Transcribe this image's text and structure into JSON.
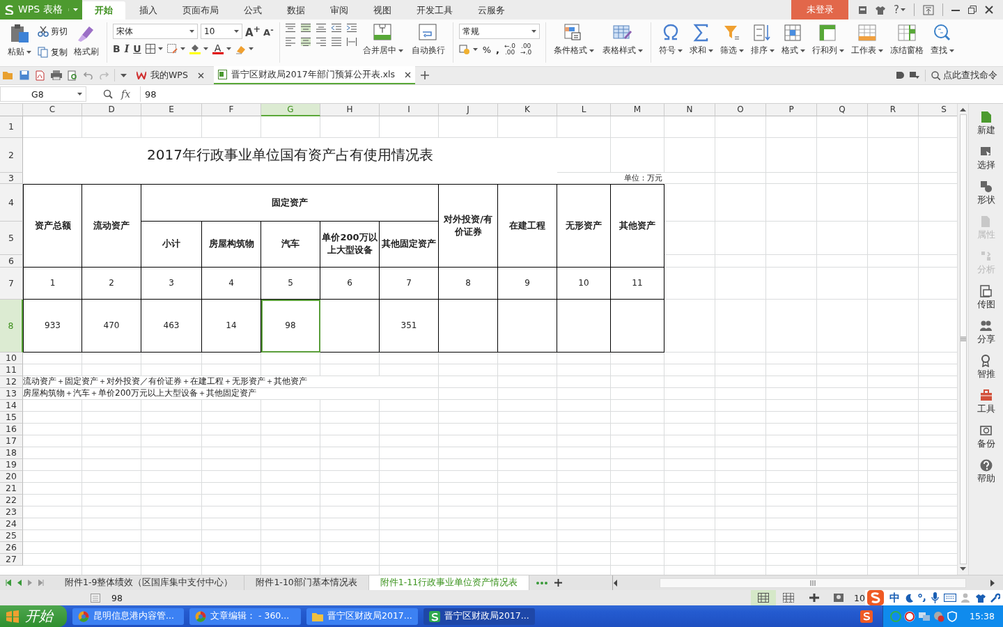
{
  "app_menu": {
    "label": "WPS 表格"
  },
  "ribbon_tabs": [
    {
      "label": "开始",
      "selected": true
    },
    {
      "label": "插入",
      "selected": false
    },
    {
      "label": "页面布局",
      "selected": false
    },
    {
      "label": "公式",
      "selected": false
    },
    {
      "label": "数据",
      "selected": false
    },
    {
      "label": "审阅",
      "selected": false
    },
    {
      "label": "视图",
      "selected": false
    },
    {
      "label": "开发工具",
      "selected": false
    },
    {
      "label": "云服务",
      "selected": false
    }
  ],
  "login_button": "未登录",
  "help_label": "?",
  "clipboard": {
    "paste": "粘贴",
    "cut": "剪切",
    "copy": "复制",
    "format_painter": "格式刷"
  },
  "font": {
    "name": "宋体",
    "size": "10",
    "grow": "A$^{+}$",
    "shrink": "A$^{-}$",
    "styles": [
      "B",
      "I",
      "U"
    ],
    "font_color_label": "A"
  },
  "alignment_buttons": [
    {
      "label": "合并居中",
      "kind": "merge",
      "menu": true
    },
    {
      "label": "自动换行",
      "kind": "wrap",
      "menu": false
    }
  ],
  "number": {
    "format": "常规",
    "percent": "%",
    "comma": ",",
    "decimals": [
      {
        "top": "←.0",
        "bottom": ".00"
      },
      {
        "top": ".00",
        "bottom": "→.0"
      }
    ]
  },
  "style_buttons": [
    {
      "label": "条件格式",
      "kind": "conditional",
      "menu": true
    },
    {
      "label": "表格样式",
      "kind": "table_style",
      "menu": true
    }
  ],
  "tool_buttons": [
    {
      "label": "符号",
      "kind": "symbol",
      "menu": true
    },
    {
      "label": "求和",
      "kind": "sum",
      "menu": true
    },
    {
      "label": "筛选",
      "kind": "filter",
      "menu": true
    },
    {
      "label": "排序",
      "kind": "sort",
      "menu": true
    },
    {
      "label": "格式",
      "kind": "format",
      "menu": true
    },
    {
      "label": "行和列",
      "kind": "rows_cols",
      "menu": true
    },
    {
      "label": "工作表",
      "kind": "sheet",
      "menu": true
    },
    {
      "label": "冻结窗格",
      "kind": "freeze",
      "menu": false
    },
    {
      "label": "查找",
      "kind": "find",
      "menu": true
    }
  ],
  "doc_tabs": [
    {
      "label": "我的WPS",
      "kind": "home",
      "selected": false
    },
    {
      "label": "晋宁区财政局2017年部门预算公开表.xls",
      "kind": "sheet",
      "selected": true
    }
  ],
  "command_search": {
    "placeholder": "点此查找命令"
  },
  "formula_bar": {
    "name_box": "G8",
    "fx": "fx",
    "value": "98"
  },
  "columns": [
    {
      "label": "C",
      "selected": false
    },
    {
      "label": "D",
      "selected": false
    },
    {
      "label": "E",
      "selected": false
    },
    {
      "label": "F",
      "selected": false
    },
    {
      "label": "G",
      "selected": true
    },
    {
      "label": "H",
      "selected": false
    },
    {
      "label": "I",
      "selected": false
    },
    {
      "label": "J",
      "selected": false
    },
    {
      "label": "K",
      "selected": false
    },
    {
      "label": "L",
      "selected": false
    },
    {
      "label": "M",
      "selected": false
    },
    {
      "label": "N",
      "selected": false
    },
    {
      "label": "O",
      "selected": false
    },
    {
      "label": "P",
      "selected": false
    },
    {
      "label": "Q",
      "selected": false
    },
    {
      "label": "R",
      "selected": false
    },
    {
      "label": "S",
      "selected": false
    }
  ],
  "rows": [
    {
      "label": "1",
      "selected": false
    },
    {
      "label": "2",
      "selected": false
    },
    {
      "label": "3",
      "selected": false
    },
    {
      "label": "4",
      "selected": false
    },
    {
      "label": "5",
      "selected": false
    },
    {
      "label": "6",
      "selected": false
    },
    {
      "label": "7",
      "selected": false
    },
    {
      "label": "8",
      "selected": true
    },
    {
      "label": "10",
      "selected": false
    },
    {
      "label": "11",
      "selected": false
    },
    {
      "label": "12",
      "selected": false
    },
    {
      "label": "13",
      "selected": false
    },
    {
      "label": "14",
      "selected": false
    },
    {
      "label": "15",
      "selected": false
    },
    {
      "label": "16",
      "selected": false
    },
    {
      "label": "17",
      "selected": false
    },
    {
      "label": "18",
      "selected": false
    },
    {
      "label": "19",
      "selected": false
    },
    {
      "label": "20",
      "selected": false
    },
    {
      "label": "21",
      "selected": false
    },
    {
      "label": "22",
      "selected": false
    },
    {
      "label": "23",
      "selected": false
    },
    {
      "label": "24",
      "selected": false
    },
    {
      "label": "25",
      "selected": false
    },
    {
      "label": "26",
      "selected": false
    },
    {
      "label": "27",
      "selected": false
    }
  ],
  "sheet": {
    "title": "2017年行政事业单位国有资产占有使用情况表",
    "unit": "单位：万元",
    "header": [
      {
        "text": "资产总额"
      },
      {
        "text": "流动资产"
      },
      {
        "text": "固定资产",
        "children": [
          {
            "text": "小计"
          },
          {
            "text": "房屋构筑物"
          },
          {
            "text": "汽车"
          },
          {
            "text": "单价200万以上大型设备"
          },
          {
            "text": "其他固定资产"
          }
        ]
      },
      {
        "text": "对外投资/有价证券"
      },
      {
        "text": "在建工程"
      },
      {
        "text": "无形资产"
      },
      {
        "text": "其他资产"
      }
    ],
    "index_row": [
      "1",
      "2",
      "3",
      "4",
      "5",
      "6",
      "7",
      "8",
      "9",
      "10",
      "11"
    ],
    "data_row": [
      {
        "value": "933",
        "selected": false
      },
      {
        "value": "470",
        "selected": false
      },
      {
        "value": "463",
        "selected": false
      },
      {
        "value": "14",
        "selected": false
      },
      {
        "value": "98",
        "selected": true
      },
      {
        "selected": false
      },
      {
        "value": "351",
        "selected": false
      },
      {
        "selected": false
      },
      {
        "selected": false
      },
      {
        "selected": false
      },
      {
        "selected": false
      }
    ],
    "notes": [
      "流动资产＋固定资产＋对外投资／有价证券＋在建工程＋无形资产＋其他资产",
      "房屋构筑物＋汽车＋单价200万元以上大型设备＋其他固定资产"
    ]
  },
  "sidebar": [
    {
      "label": "新建",
      "kind": "new",
      "disabled": false
    },
    {
      "label": "选择",
      "kind": "select",
      "disabled": false
    },
    {
      "label": "形状",
      "kind": "shape",
      "disabled": false
    },
    {
      "label": "属性",
      "kind": "props",
      "disabled": true
    },
    {
      "label": "分析",
      "kind": "analyze",
      "disabled": true
    },
    {
      "label": "传图",
      "kind": "image",
      "disabled": false
    },
    {
      "label": "分享",
      "kind": "share",
      "disabled": false
    },
    {
      "label": "智推",
      "kind": "recommend",
      "disabled": false
    },
    {
      "label": "工具",
      "kind": "tools",
      "disabled": false
    },
    {
      "label": "备份",
      "kind": "backup",
      "disabled": false
    },
    {
      "label": "帮助",
      "kind": "help",
      "disabled": false
    }
  ],
  "sheet_tabs": [
    {
      "label": "附件1-9整体绩效（区国库集中支付中心）",
      "selected": false
    },
    {
      "label": "附件1-10部门基本情况表",
      "selected": false
    },
    {
      "label": "附件1-11行政事业单位资产情况表",
      "selected": true
    }
  ],
  "status_bar": {
    "value": "98",
    "zoom": "10",
    "ime": "中",
    "view_modes": [
      {
        "kind": "normal",
        "selected": true
      },
      {
        "kind": "page_break",
        "selected": false
      },
      {
        "kind": "layout",
        "selected": false
      },
      {
        "kind": "reading",
        "selected": false
      }
    ]
  },
  "taskbar": {
    "start": "开始",
    "tasks": [
      {
        "label": "昆明信息港内容管...",
        "kind": "browser",
        "selected": false
      },
      {
        "label": "文章编辑： - 360...",
        "kind": "browser",
        "selected": false
      },
      {
        "label": "晋宁区财政局2017...",
        "kind": "folder",
        "selected": false
      },
      {
        "label": "晋宁区财政局2017...",
        "kind": "spreadsheet",
        "selected": true
      }
    ],
    "time": "15:38"
  }
}
